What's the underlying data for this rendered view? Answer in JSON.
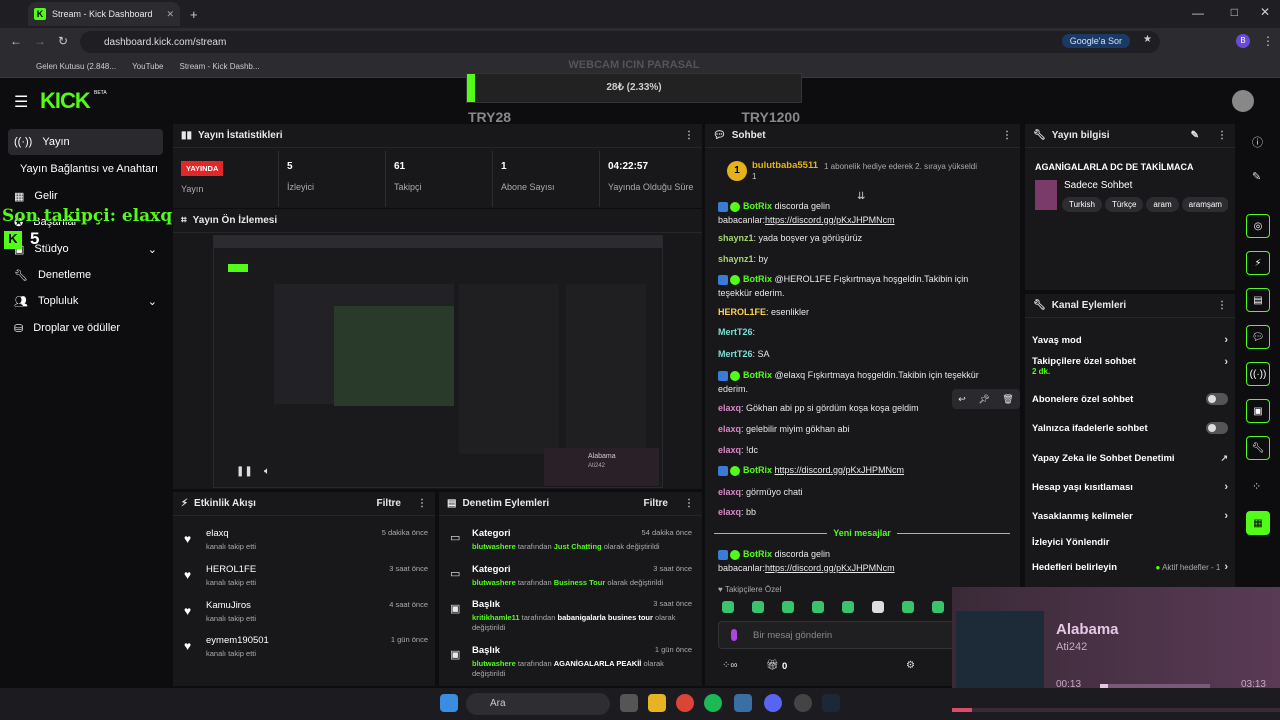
{
  "browser": {
    "tab_title": "Stream - Kick Dashboard",
    "url": "dashboard.kick.com/stream",
    "google_btn": "Google'a Sor",
    "profile": "B",
    "bookmarks": [
      "Gelen Kutusu (2.848...",
      "YouTube",
      "Stream - Kick Dashb..."
    ]
  },
  "goal": {
    "title": "WEBCAM ICIN PARASAL",
    "progress_text": "28₺ (2.33%)",
    "progress_pct": 2.33,
    "left": "TRY28",
    "right": "TRY1200"
  },
  "overlay": {
    "follower": "Son takipçi: elaxq",
    "count": "5"
  },
  "sidebar": {
    "logo": "KICK",
    "beta": "BETA",
    "items": [
      "Yayın",
      "Yayın Bağlantısı ve Anahtarı",
      "Gelir",
      "Başarılar",
      "Stüdyo",
      "Denetleme",
      "Topluluk",
      "Droplar ve ödüller"
    ]
  },
  "stats": {
    "title": "Yayın İstatistikleri",
    "live": "YAYINDA",
    "live_label": "Yayın",
    "items": [
      {
        "value": "5",
        "label": "İzleyici"
      },
      {
        "value": "61",
        "label": "Takipçi"
      },
      {
        "value": "1",
        "label": "Abone Sayısı"
      },
      {
        "value": "04:22:57",
        "label": "Yayında Olduğu Süre"
      }
    ]
  },
  "preview": {
    "title": "Yayın Ön İzlemesi",
    "song": "Alabama",
    "artist": "Ati242"
  },
  "activity": {
    "title": "Etkinlik Akışı",
    "filter": "Filtre",
    "items": [
      {
        "name": "elaxq",
        "sub": "kanalı takip etti",
        "time": "5 dakika önce"
      },
      {
        "name": "HEROL1FE",
        "sub": "kanalı takip etti",
        "time": "3 saat önce"
      },
      {
        "name": "KamuJiros",
        "sub": "kanalı takip etti",
        "time": "4 saat önce"
      },
      {
        "name": "eymem190501",
        "sub": "kanalı takip etti",
        "time": "1 gün önce"
      }
    ]
  },
  "moderation": {
    "title": "Denetim Eylemleri",
    "filter": "Filtre",
    "items": [
      {
        "name": "Kategori",
        "user": "blutwashere",
        "mid": " tarafından ",
        "target": "Just Chatting",
        "end": " olarak değiştirildi",
        "time": "54 dakika önce"
      },
      {
        "name": "Kategori",
        "user": "blutwashere",
        "mid": " tarafından ",
        "target": "Business Tour",
        "end": " olarak değiştirildi",
        "time": "3 saat önce"
      },
      {
        "name": "Başlık",
        "user": "kritikhamle11",
        "mid": " tarafından ",
        "target": "babanigalarla busines tour",
        "end": " olarak değiştirildi",
        "time": "3 saat önce"
      },
      {
        "name": "Başlık",
        "user": "blutwashere",
        "mid": " tarafından ",
        "target": "AGANİGALARLA PEAKİİ",
        "end": " olarak değiştirildi",
        "time": "1 gün önce"
      }
    ]
  },
  "chat": {
    "title": "Sohbet",
    "pinned_user": "bulutbaba5511",
    "pinned_level": "1",
    "pinned_sub": "1",
    "pinned_text": "1 abonelik hediye ederek 2. sıraya yükseldi",
    "messages": [
      {
        "user": "BotRix",
        "cls": "u-b",
        "bot": true,
        "text": " discorda gelin babacanlar:",
        "link": "https://discord.gg/pKxJHPMNcm"
      },
      {
        "user": "shaynz1",
        "cls": "u-g",
        "text": ": yada boşver ya görüşürüz"
      },
      {
        "user": "shaynz1",
        "cls": "u-g",
        "text": ": by"
      },
      {
        "user": "BotRix",
        "cls": "u-b",
        "bot": true,
        "text": " @HEROL1FE Fışkırtmaya hoşgeldin.Takibin için teşekkür ederim."
      },
      {
        "user": "HEROL1FE",
        "cls": "u-y",
        "text": ": esenlikler"
      },
      {
        "user": "MertT26",
        "cls": "u-t",
        "text": ":"
      },
      {
        "user": "MertT26",
        "cls": "u-t",
        "text": ": SA"
      },
      {
        "user": "BotRix",
        "cls": "u-b",
        "bot": true,
        "text": " @elaxq Fışkırtmaya hoşgeldin.Takibin için teşekkür ederim."
      },
      {
        "user": "elaxq",
        "cls": "u-p",
        "text": ": Gökhan abi pp si gördüm koşa koşa geldim"
      },
      {
        "user": "elaxq",
        "cls": "u-p",
        "text": ": gelebilir miyim gökhan abi"
      },
      {
        "user": "elaxq",
        "cls": "u-p",
        "text": ": !dc"
      },
      {
        "user": "BotRix",
        "cls": "u-b",
        "bot": true,
        "text": " ",
        "link": "https://discord.gg/pKxJHPMNcm"
      },
      {
        "user": "elaxq",
        "cls": "u-p",
        "text": ": görmüyo chati"
      },
      {
        "user": "elaxq",
        "cls": "u-p",
        "text": ": bb"
      },
      {
        "user": "BotRix",
        "cls": "u-b",
        "bot": true,
        "text": " discorda gelin babacanlar:",
        "link": "https://discord.gg/pKxJHPMNcm"
      }
    ],
    "new_messages": "Yeni mesajlar",
    "followers_only": "Takipçilere Özel",
    "placeholder": "Bir mesaj gönderin",
    "points": "0"
  },
  "stream_info": {
    "title": "Yayın bilgisi",
    "stream_title": "AGANİGALARLA DC DE TAKİLMACA",
    "category": "Sadece Sohbet",
    "tags": [
      "Turkish",
      "Türkçe",
      "aram",
      "aramşam"
    ]
  },
  "channel_actions": {
    "title": "Kanal Eylemleri",
    "items": [
      "Yavaş mod",
      "Takipçilere özel sohbet",
      "Abonelere özel sohbet",
      "Yalnızca ifadelerle sohbet",
      "Yapay Zeka ile Sohbet Denetimi",
      "Hesap yaşı kısıtlaması",
      "Yasaklanmış kelimeler",
      "İzleyici Yönlendir",
      "Hedefleri belirleyin"
    ],
    "followers_sub": "2 dk.",
    "goals_sub": "Aktif hedefler - 1"
  },
  "music": {
    "song": "Alabama",
    "artist": "Ati242",
    "elapsed": "00:13",
    "total": "03:13",
    "progress": 0.07
  },
  "taskbar": {
    "search": "Ara"
  }
}
